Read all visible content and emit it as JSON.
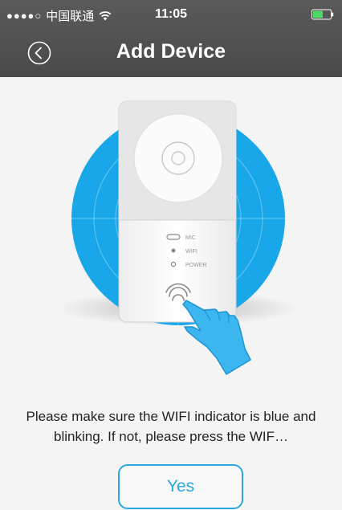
{
  "status_bar": {
    "signal": "●●●●○",
    "carrier": "中国联通",
    "time": "11:05",
    "icons": {
      "wifi": "wifi-icon",
      "battery": "battery-icon"
    }
  },
  "nav": {
    "title": "Add Device",
    "back_icon": "chevron-left-circle-icon"
  },
  "illustration": {
    "indicator_labels": [
      "MIC",
      "WIFI",
      "POWER"
    ],
    "accent_color": "#19a7ea",
    "hand_color": "#3cb6ef"
  },
  "instruction": "Please make sure the WIFI indicator is blue and blinking. If not, please press the WIF…",
  "confirm_button": {
    "label": "Yes",
    "color": "#2ba8e0"
  }
}
